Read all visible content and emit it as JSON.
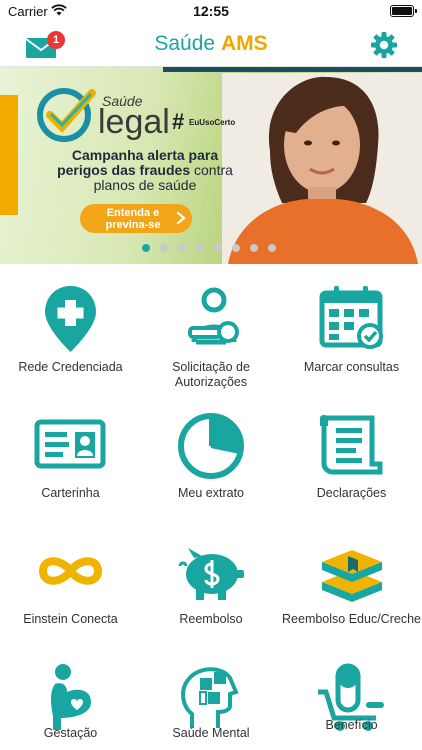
{
  "status_bar": {
    "carrier": "Carrier",
    "time": "12:55"
  },
  "nav": {
    "mail_badge": "1",
    "brand_part1": "Saúde",
    "brand_part2": "AMS",
    "mail_icon": "mail-icon",
    "settings_icon": "gear-icon"
  },
  "banner": {
    "logo_small": "Saúde",
    "logo_main": "legal",
    "hashtag_symbol": "#",
    "hashtag_text": "EuUsoCerto",
    "headline_1": "Campanha alerta para",
    "headline_2a": "perigos das ",
    "headline_2b": "fraudes",
    "headline_2c": " contra",
    "headline_3": "planos de saúde",
    "cta_label": "Entenda e previna-se",
    "dots_count": 8,
    "active_dot": 0
  },
  "menu": [
    {
      "label": "Rede Credenciada",
      "icon": "location-pin-plus-icon"
    },
    {
      "label": "Solicitação de Autorizações",
      "icon": "person-key-icon"
    },
    {
      "label": "Marcar consultas",
      "icon": "calendar-check-icon"
    },
    {
      "label": "Carterinha",
      "icon": "id-card-icon"
    },
    {
      "label": "Meu extrato",
      "icon": "pie-chart-icon"
    },
    {
      "label": "Declarações",
      "icon": "document-scroll-icon"
    },
    {
      "label": "Einstein Conecta",
      "icon": "infinity-icon"
    },
    {
      "label": "Reembolso",
      "icon": "piggy-bank-icon"
    },
    {
      "label": "Reembolso Educ/Creche",
      "icon": "books-icon"
    },
    {
      "label": "Gestação",
      "icon": "pregnant-icon"
    },
    {
      "label": "Saúde Mental",
      "icon": "head-puzzle-icon"
    },
    {
      "label": "Benefício",
      "icon": "pill-cart-icon"
    }
  ],
  "colors": {
    "teal": "#1aa6a0",
    "orange": "#f0a500",
    "badge": "#e53935"
  }
}
